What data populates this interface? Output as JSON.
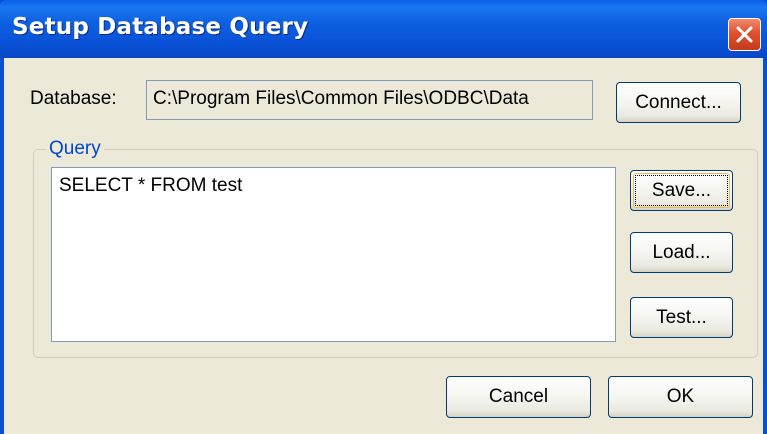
{
  "window": {
    "title": "Setup Database Query"
  },
  "database": {
    "label": "Database:",
    "value": "C:\\Program Files\\Common Files\\ODBC\\Data",
    "connect_label": "Connect..."
  },
  "query": {
    "group_label": "Query",
    "text": "SELECT * FROM test",
    "save_label": "Save...",
    "load_label": "Load...",
    "test_label": "Test..."
  },
  "footer": {
    "cancel_label": "Cancel",
    "ok_label": "OK"
  },
  "icons": {
    "close": "close-icon"
  },
  "colors": {
    "titlebar": "#0a52d8",
    "client_bg": "#ece9d8",
    "group_label": "#0046d5",
    "close_button": "#e0502f"
  }
}
